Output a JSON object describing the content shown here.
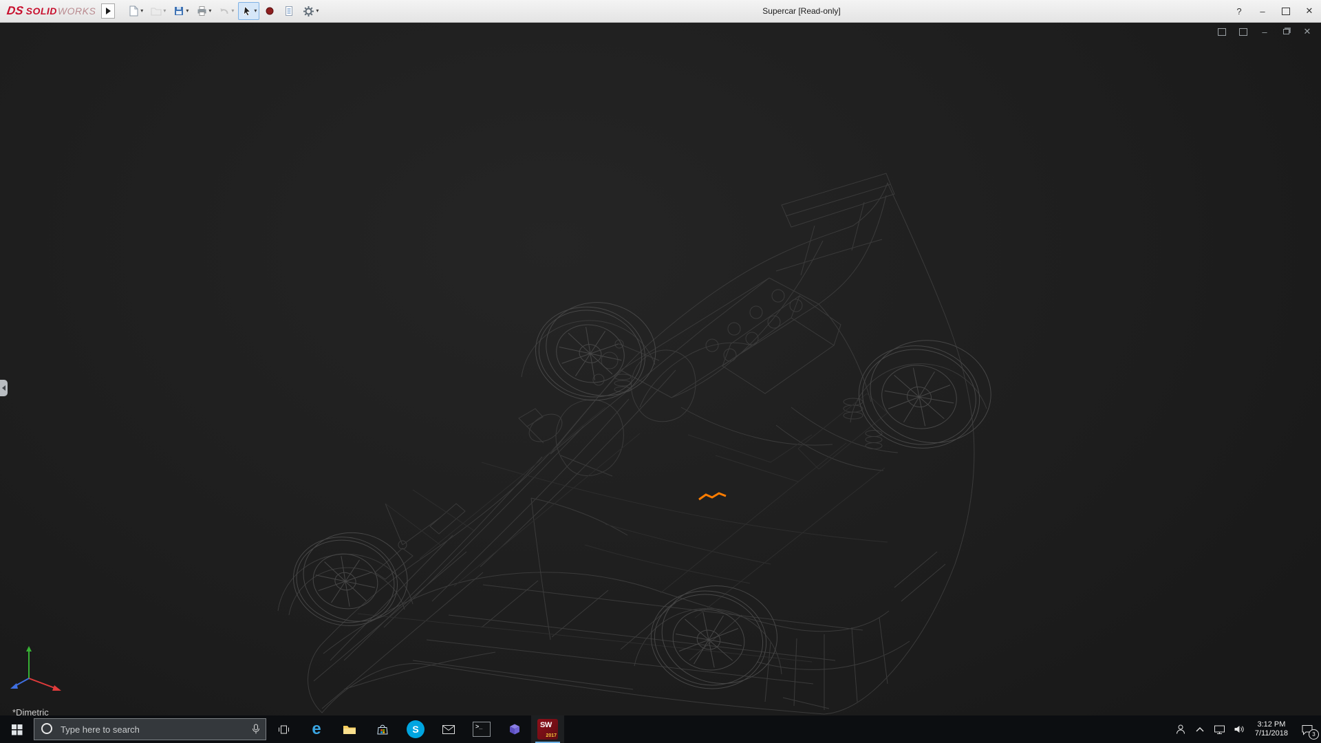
{
  "titlebar": {
    "logo": "DS",
    "brand_solid": "SOLID",
    "brand_works": "WORKS",
    "title": "Supercar [Read-only]",
    "help_glyph": "?",
    "minimize_glyph": "–",
    "close_glyph": "✕",
    "caret_glyph": "▾"
  },
  "viewport": {
    "orientation": "*Dimetric",
    "doc_minimize_glyph": "–",
    "doc_close_glyph": "✕",
    "selection_color": "#ff7d00",
    "wireframe_color": "#3b3b3b",
    "background_color": "#1d1d1d"
  },
  "taskbar": {
    "search_placeholder": "Type here to search",
    "time": "3:12 PM",
    "date": "7/11/2018",
    "notification_count": "3",
    "sw_label": "SW",
    "sw_year": "2017",
    "edge_letter": "e",
    "skype_letter": "S",
    "console_prompt": ">_"
  }
}
